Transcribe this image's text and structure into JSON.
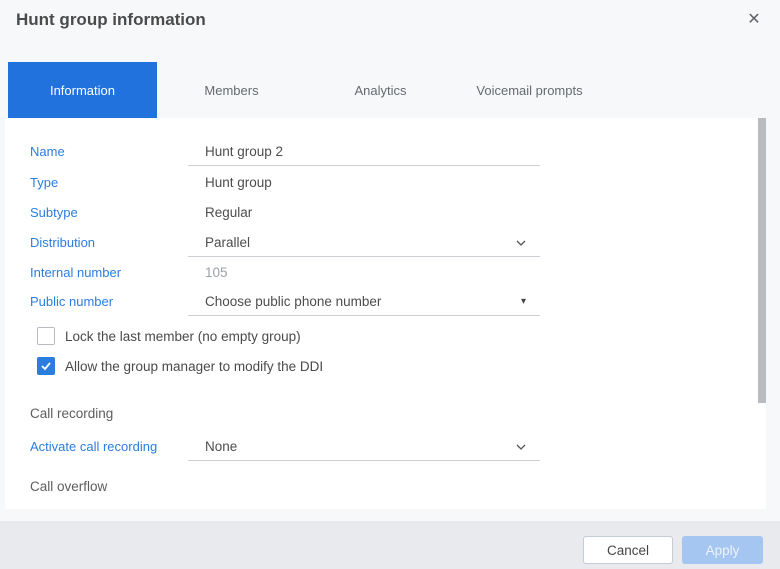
{
  "colors": {
    "tab_active": "#2272dd",
    "label_blue": "#2b7de0",
    "checkbox_checked": "#2b7de0",
    "apply_disabled": "#a4c6f1",
    "footer_bg": "#e8eaee"
  },
  "header": {
    "title": "Hunt group information",
    "close_icon": "✕"
  },
  "tabs": [
    {
      "label": "Information",
      "active": true
    },
    {
      "label": "Members",
      "active": false
    },
    {
      "label": "Analytics",
      "active": false
    },
    {
      "label": "Voicemail prompts",
      "active": false
    }
  ],
  "form": {
    "fields": [
      {
        "label": "Name",
        "value": "Hunt group 2",
        "type": "text-input"
      },
      {
        "label": "Type",
        "value": "Hunt group",
        "type": "readonly"
      },
      {
        "label": "Subtype",
        "value": "Regular",
        "type": "readonly"
      },
      {
        "label": "Distribution",
        "value": "Parallel",
        "type": "select"
      },
      {
        "label": "Internal number",
        "value": "105",
        "type": "disabled"
      },
      {
        "label": "Public number",
        "value": "Choose public phone number",
        "type": "native-select",
        "caret_icon": "▾"
      }
    ],
    "checkboxes": [
      {
        "label": "Lock the last member (no empty group)",
        "checked": false
      },
      {
        "label": "Allow the group manager to modify the DDI",
        "checked": true
      }
    ],
    "sections": {
      "call_recording": {
        "heading": "Call recording",
        "field": {
          "label": "Activate call recording",
          "value": "None",
          "type": "select"
        }
      },
      "call_overflow": {
        "heading": "Call overflow"
      }
    }
  },
  "footer": {
    "cancel_label": "Cancel",
    "apply_label": "Apply"
  }
}
